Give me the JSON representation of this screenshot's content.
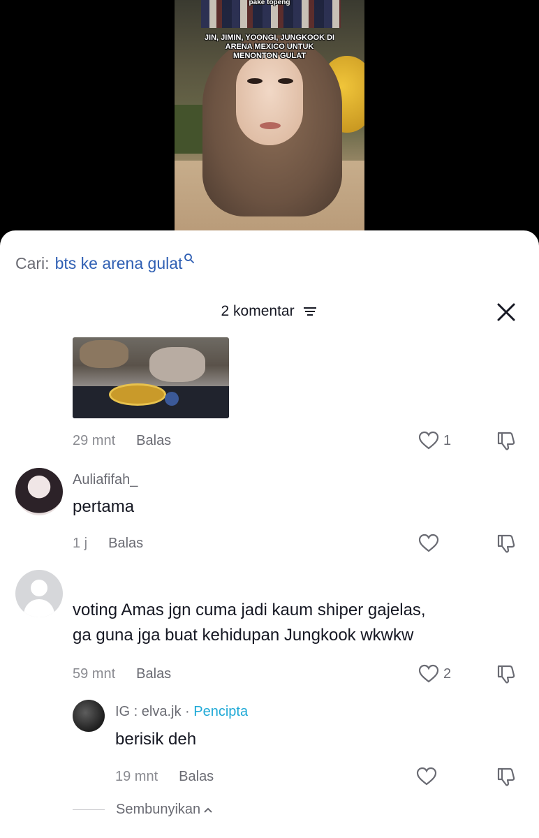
{
  "video": {
    "caption_top": "pake topeng",
    "caption_main": "JIN, JIMIN, YOONGI, JUNGKOOK DI\nARENA MEXICO UNTUK\nMENONTON GULAT"
  },
  "search": {
    "label": "Cari:",
    "query": "bts ke arena gulat"
  },
  "header": {
    "count": "2 komentar"
  },
  "comments": [
    {
      "time": "29 mnt",
      "reply": "Balas",
      "likes": "1"
    },
    {
      "username": "Auliafifah_",
      "text": "pertama",
      "time": "1 j",
      "reply": "Balas",
      "likes": ""
    },
    {
      "username": "",
      "text": "voting Amas jgn cuma jadi kaum shiper gajelas,\nga guna jga buat kehidupan Jungkook wkwkw",
      "time": "59 mnt",
      "reply": "Balas",
      "likes": "2"
    },
    {
      "username": "IG : elva.jk",
      "separator": " · ",
      "badge": "Pencipta",
      "text": "berisik deh",
      "time": "19 mnt",
      "reply": "Balas",
      "likes": ""
    }
  ],
  "hide_replies": "Sembunyikan",
  "colors": {
    "link_blue": "#2f5fb3",
    "creator_cyan": "#1fa9d6",
    "muted_gray": "#8a8b91"
  }
}
